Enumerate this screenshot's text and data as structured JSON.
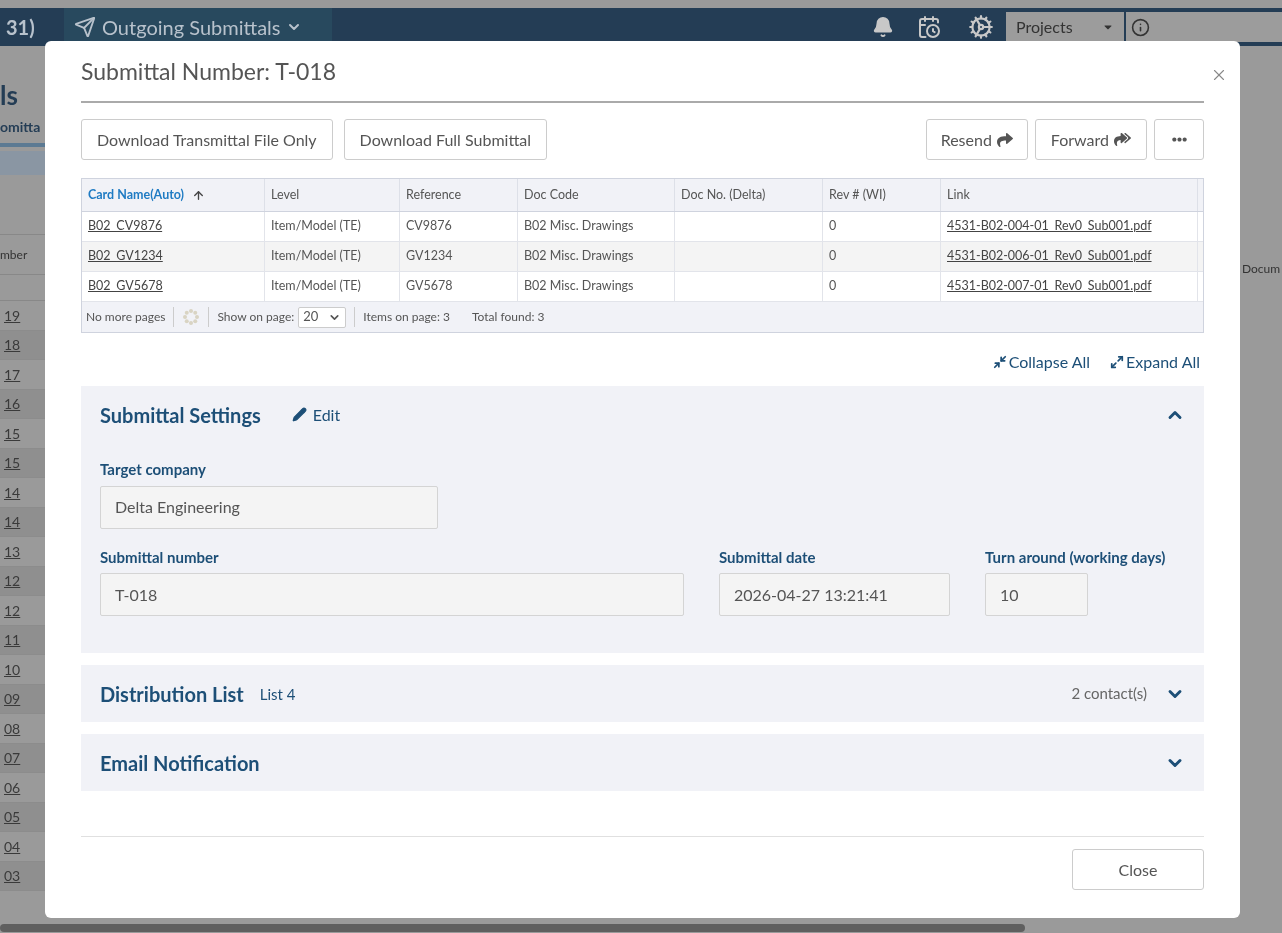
{
  "background": {
    "header": {
      "breadcrumb_prefix": "31)",
      "breadcrumb": "Outgoing Submittals",
      "project_select": "Projects"
    },
    "page_title": "ls",
    "tab": "omitta",
    "column_header": "mber",
    "column_header_right": "Docum",
    "row_numbers": [
      "19",
      "18",
      "17",
      "16",
      "15",
      "15",
      "14",
      "14",
      "13",
      "12",
      "12",
      "11",
      "10",
      "09",
      "08",
      "07",
      "06",
      "05",
      "04",
      "03"
    ]
  },
  "modal": {
    "title": "Submittal Number: T-018",
    "buttons_left": [
      "Download Transmittal File Only",
      "Download Full Submittal"
    ],
    "resend": "Resend",
    "forward": "Forward",
    "table": {
      "columns": [
        {
          "label": "Card Name(Auto)",
          "sorted": true
        },
        {
          "label": "Level",
          "sorted": false
        },
        {
          "label": "Reference",
          "sorted": false
        },
        {
          "label": "Doc Code",
          "sorted": false
        },
        {
          "label": "Doc No. (Delta)",
          "sorted": false
        },
        {
          "label": "Rev # (WI)",
          "sorted": false
        },
        {
          "label": "Link",
          "sorted": false
        }
      ],
      "rows": [
        [
          "B02_CV9876",
          "Item/Model (TE)",
          "CV9876",
          "B02 Misc. Drawings",
          "",
          "0",
          "4531-B02-004-01_Rev0_Sub001.pdf"
        ],
        [
          "B02_GV1234",
          "Item/Model (TE)",
          "GV1234",
          "B02 Misc. Drawings",
          "",
          "0",
          "4531-B02-006-01_Rev0_Sub001.pdf"
        ],
        [
          "B02_GV5678",
          "Item/Model (TE)",
          "GV5678",
          "B02 Misc. Drawings",
          "",
          "0",
          "4531-B02-007-01_Rev0_Sub001.pdf"
        ]
      ],
      "footer": {
        "pages": "No more pages",
        "show_label": "Show on page:",
        "page_size": "20",
        "items": "Items on page: 3",
        "total": "Total found: 3"
      }
    },
    "collapse_all": "Collapse All",
    "expand_all": "Expand All",
    "sections": [
      {
        "kind": "settings",
        "title": "Submittal Settings",
        "edit": "Edit",
        "expanded": true,
        "fields": [
          {
            "label": "Target company",
            "value": "Delta Engineering"
          },
          {
            "label": "Submittal number",
            "value": "T-018"
          },
          {
            "label": "Submittal date",
            "value": "2026-04-27 13:21:41"
          },
          {
            "label": "Turn around (working days)",
            "value": "10"
          }
        ]
      },
      {
        "kind": "list",
        "title": "Distribution List",
        "subtitle": "List 4",
        "count": "2 contact(s)",
        "expanded": false
      },
      {
        "kind": "plain",
        "title": "Email Notification",
        "expanded": false
      }
    ],
    "close": "Close"
  }
}
